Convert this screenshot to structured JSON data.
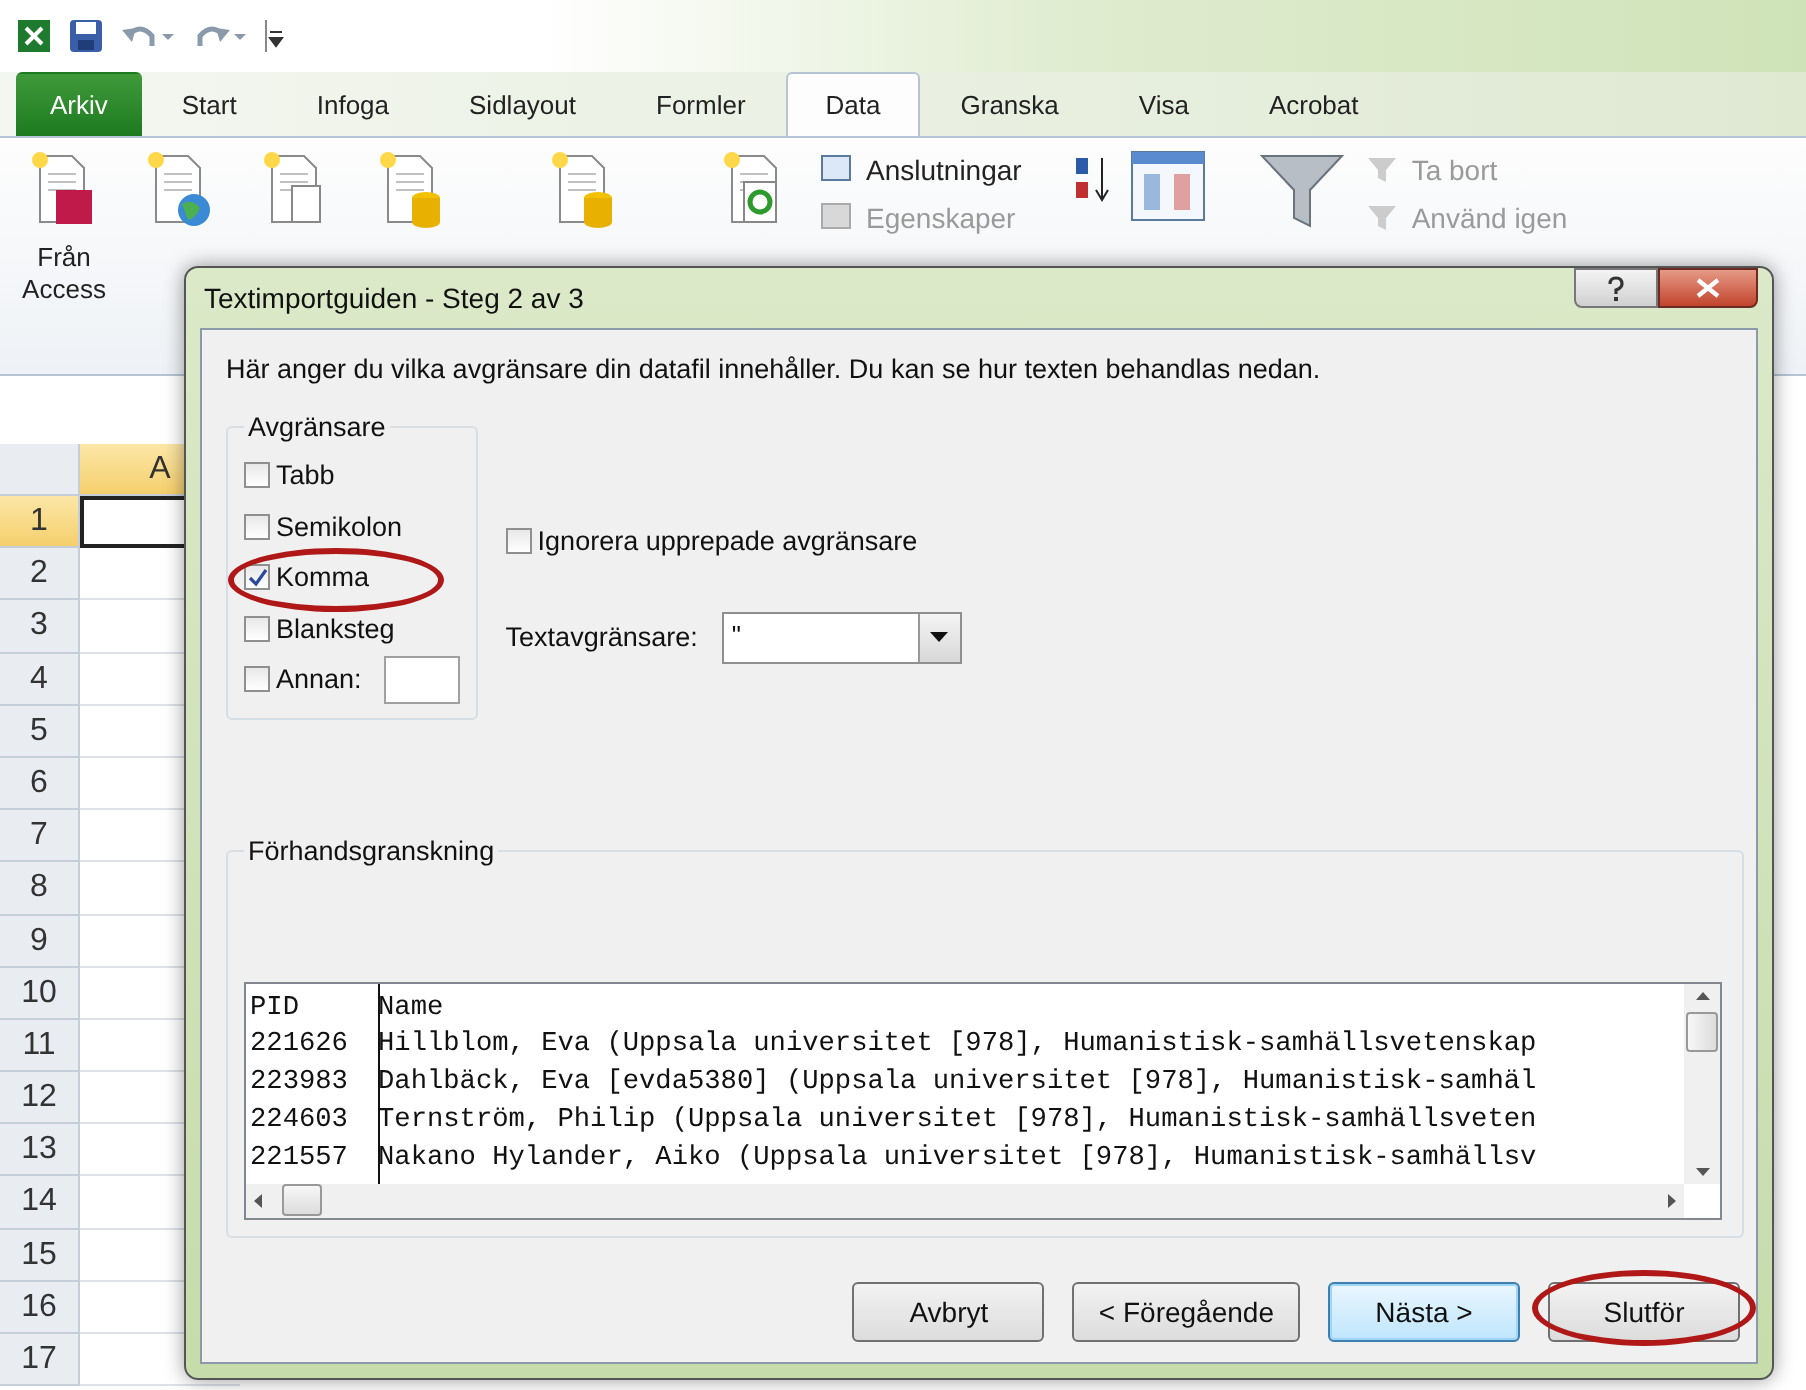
{
  "ribbon_tabs": [
    {
      "label": "Arkiv",
      "kind": "file",
      "selected": false
    },
    {
      "label": "Start",
      "kind": "tab",
      "selected": false
    },
    {
      "label": "Infoga",
      "kind": "tab",
      "selected": false
    },
    {
      "label": "Sidlayout",
      "kind": "tab",
      "selected": false
    },
    {
      "label": "Formler",
      "kind": "tab",
      "selected": false
    },
    {
      "label": "Data",
      "kind": "tab",
      "selected": true
    },
    {
      "label": "Granska",
      "kind": "tab",
      "selected": false
    },
    {
      "label": "Visa",
      "kind": "tab",
      "selected": false
    },
    {
      "label": "Acrobat",
      "kind": "tab",
      "selected": false
    }
  ],
  "ribbon": {
    "access_button": {
      "label": "Från Access"
    },
    "connections": [
      {
        "label": "Anslutningar",
        "disabled": false
      },
      {
        "label": "Egenskaper",
        "disabled": true
      }
    ],
    "filter_commands": [
      {
        "label": "Ta bort",
        "disabled": true
      },
      {
        "label": "Använd igen",
        "disabled": true
      }
    ]
  },
  "sheet": {
    "column_header": "A",
    "rows": [
      {
        "label": "1",
        "selected": true
      },
      {
        "label": "2",
        "selected": false
      },
      {
        "label": "3",
        "selected": false
      },
      {
        "label": "4",
        "selected": false
      },
      {
        "label": "5",
        "selected": false
      },
      {
        "label": "6",
        "selected": false
      },
      {
        "label": "7",
        "selected": false
      },
      {
        "label": "8",
        "selected": false
      },
      {
        "label": "9",
        "selected": false
      },
      {
        "label": "10",
        "selected": false
      },
      {
        "label": "11",
        "selected": false
      },
      {
        "label": "12",
        "selected": false
      },
      {
        "label": "13",
        "selected": false
      },
      {
        "label": "14",
        "selected": false
      },
      {
        "label": "15",
        "selected": false
      },
      {
        "label": "16",
        "selected": false
      },
      {
        "label": "17",
        "selected": false
      }
    ]
  },
  "dialog": {
    "title": "Textimportguiden - Steg 2 av 3",
    "intro": "Här anger du vilka avgränsare din datafil innehåller. Du kan se hur texten behandlas nedan.",
    "delimiters": {
      "title": "Avgränsare",
      "options": [
        {
          "label": "Tabb",
          "kind": "plain",
          "checked": false,
          "circled": false
        },
        {
          "label": "Semikolon",
          "kind": "plain",
          "checked": false,
          "circled": false
        },
        {
          "label": "Komma",
          "kind": "plain",
          "checked": true,
          "circled": true
        },
        {
          "label": "Blanksteg",
          "kind": "plain",
          "checked": false,
          "circled": false
        },
        {
          "label": "Annan:",
          "kind": "other",
          "checked": false,
          "circled": false
        }
      ]
    },
    "consecutive": {
      "label": "Ignorera upprepade avgränsare",
      "checked": false
    },
    "qualifier": {
      "label": "Textavgränsare:",
      "value": "\""
    },
    "preview": {
      "title": "Förhandsgranskning",
      "rows": [
        [
          "PID",
          "Name"
        ],
        [
          "221626",
          "Hillblom, Eva (Uppsala universitet [978], Humanistisk-samhällsvetenskap"
        ],
        [
          "223983",
          "Dahlbäck, Eva [evda5380] (Uppsala universitet [978], Humanistisk-samhäl"
        ],
        [
          "224603",
          "Ternström, Philip (Uppsala universitet [978], Humanistisk-samhällsveten"
        ],
        [
          "221557",
          "Nakano Hylander, Aiko (Uppsala universitet [978], Humanistisk-samhällsv"
        ]
      ]
    },
    "buttons": [
      {
        "label": "Avbryt",
        "default": false,
        "circled": false
      },
      {
        "label": "< Föregående",
        "default": false,
        "circled": false
      },
      {
        "label": "Nästa >",
        "default": true,
        "circled": false
      },
      {
        "label": "Slutför",
        "default": false,
        "circled": true
      }
    ]
  }
}
